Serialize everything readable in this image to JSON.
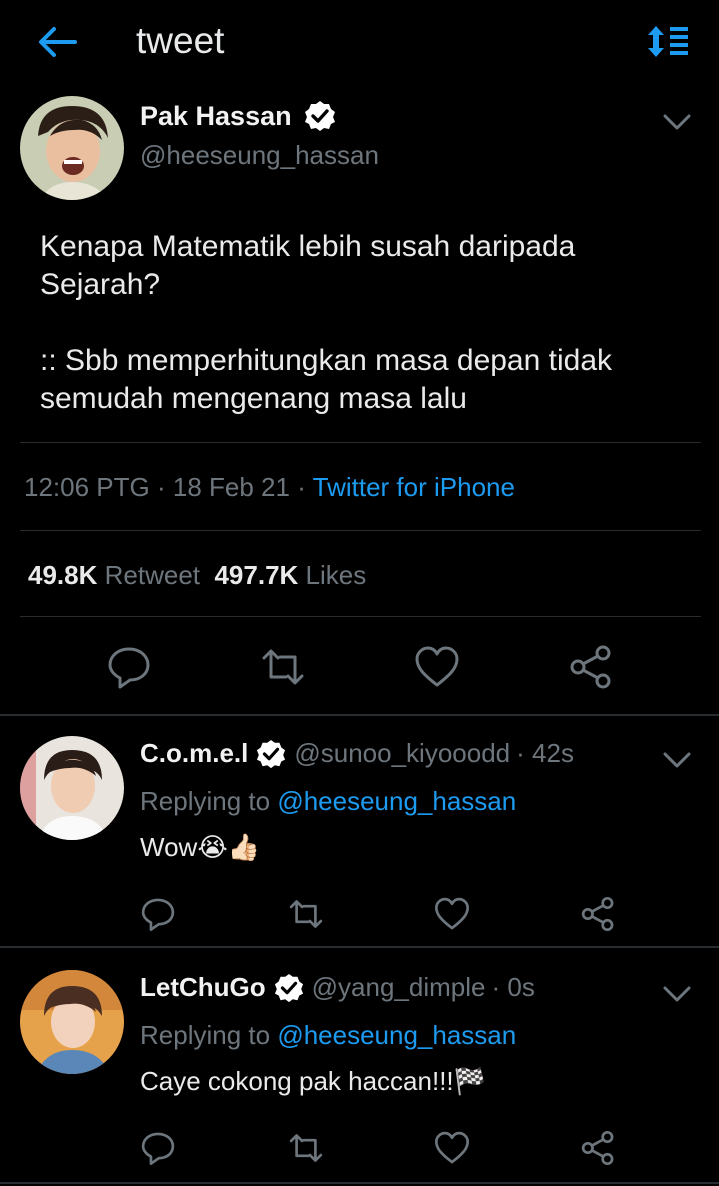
{
  "header": {
    "title": "tweet",
    "back_icon": "arrow-left-icon",
    "sort_icon": "sort-lines-icon"
  },
  "tweet": {
    "author_name": "Pak Hassan",
    "author_handle": "@heeseung_hassan",
    "text_line_1": "Kenapa Matematik lebih susah daripada Sejarah?",
    "text_line_2": ":: Sbb memperhitungkan masa depan tidak semudah mengenang masa lalu",
    "time": "12:06 PTG",
    "separator": "·",
    "date": "18 Feb 21",
    "source": "Twitter for iPhone",
    "retweet_count": "49.8K",
    "retweet_label": "Retweet",
    "like_count": "497.7K",
    "like_label": "Likes"
  },
  "replies": [
    {
      "name": "C.o.m.e.l",
      "handle": "@sunoo_kiyooodd",
      "age": "· 42s",
      "replying_prefix": "Replying to",
      "replying_to": "@heeseung_hassan",
      "text": "Wow",
      "emoji": "😭👍🏻"
    },
    {
      "name": "LetChuGo",
      "handle": "@yang_dimple",
      "age": "· 0s",
      "replying_prefix": "Replying to",
      "replying_to": "@heeseung_hassan",
      "text": "Caye cokong pak haccan!!!",
      "emoji": "🏁"
    }
  ],
  "colors": {
    "background": "#000000",
    "accent": "#1d9bf0",
    "muted": "#6e767d",
    "text": "#e7e9ea",
    "divider": "#2a2d30"
  }
}
